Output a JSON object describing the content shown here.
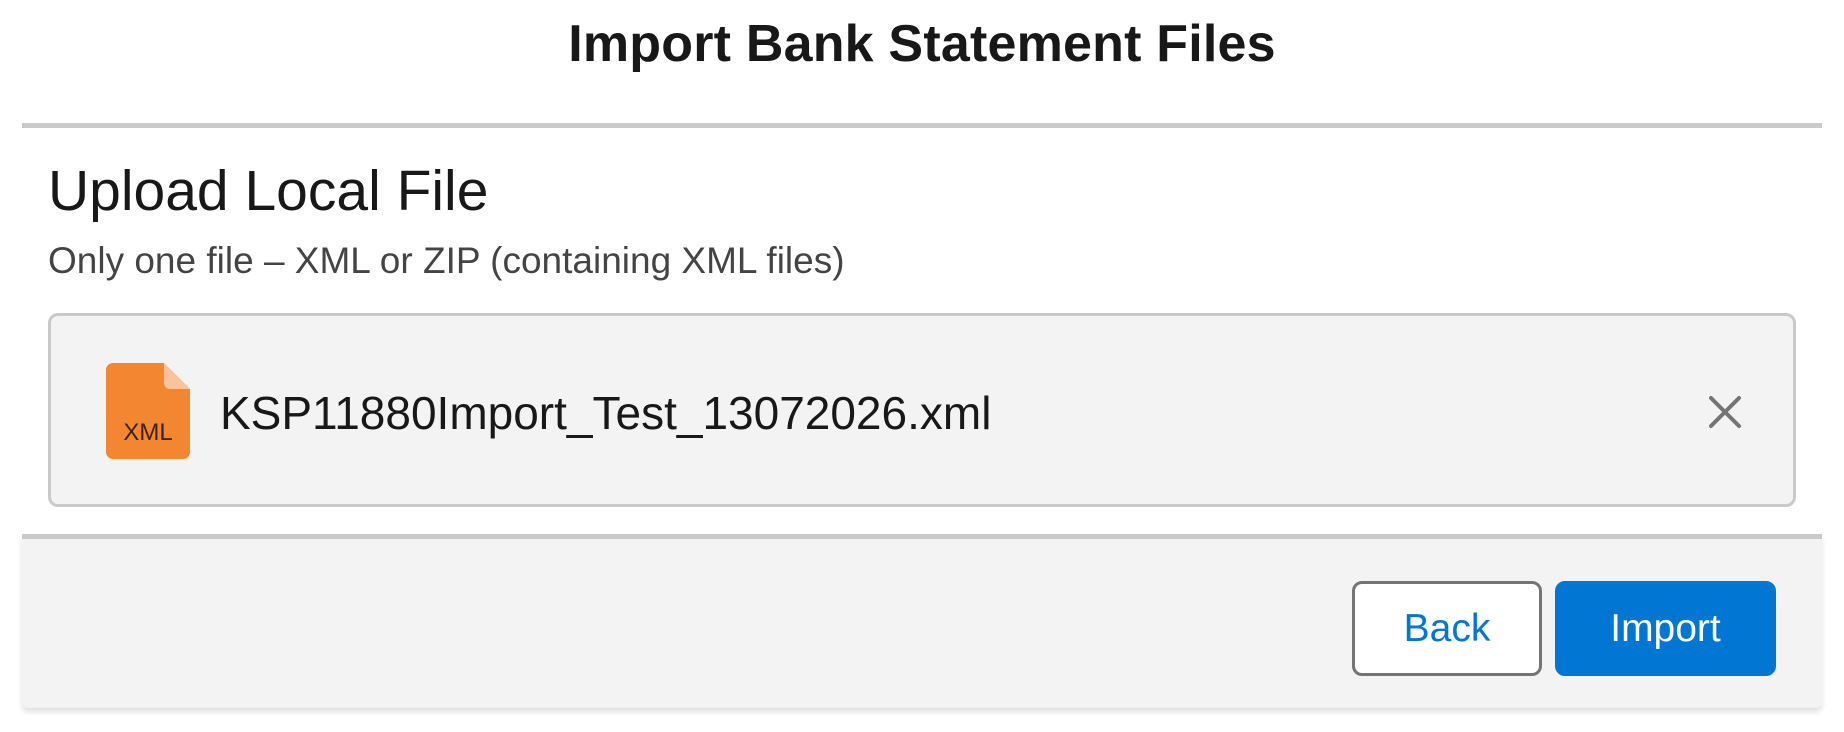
{
  "modal": {
    "title": "Import Bank Statement Files"
  },
  "upload": {
    "title": "Upload Local File",
    "help": "Only one file – XML or ZIP (containing XML files)"
  },
  "file": {
    "name": "KSP11880Import_Test_13072026.xml",
    "type_label": "XML",
    "icon": "xml-file-icon",
    "icon_color": "#F38630",
    "remove_icon": "close-icon"
  },
  "footer": {
    "back_label": "Back",
    "import_label": "Import"
  },
  "colors": {
    "brand": "#0176D3",
    "divider": "#C9C9C9",
    "panel_bg": "#F3F3F3"
  }
}
